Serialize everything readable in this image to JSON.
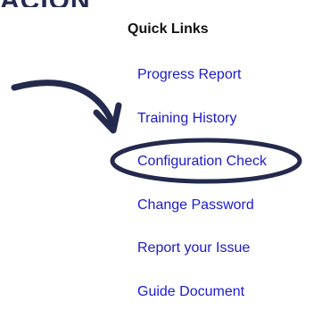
{
  "header": {
    "partial_title": "ACION"
  },
  "quick_links": {
    "title": "Quick Links",
    "items": [
      {
        "label": "Progress Report"
      },
      {
        "label": "Training History"
      },
      {
        "label": "Configuration Check"
      },
      {
        "label": "Change Password"
      },
      {
        "label": "Report your Issue"
      },
      {
        "label": "Guide Document"
      }
    ]
  },
  "annotation": {
    "color": "#232a4d",
    "highlighted_item": "Configuration Check",
    "icons": [
      "curved-arrow-icon",
      "highlight-ellipse"
    ]
  }
}
